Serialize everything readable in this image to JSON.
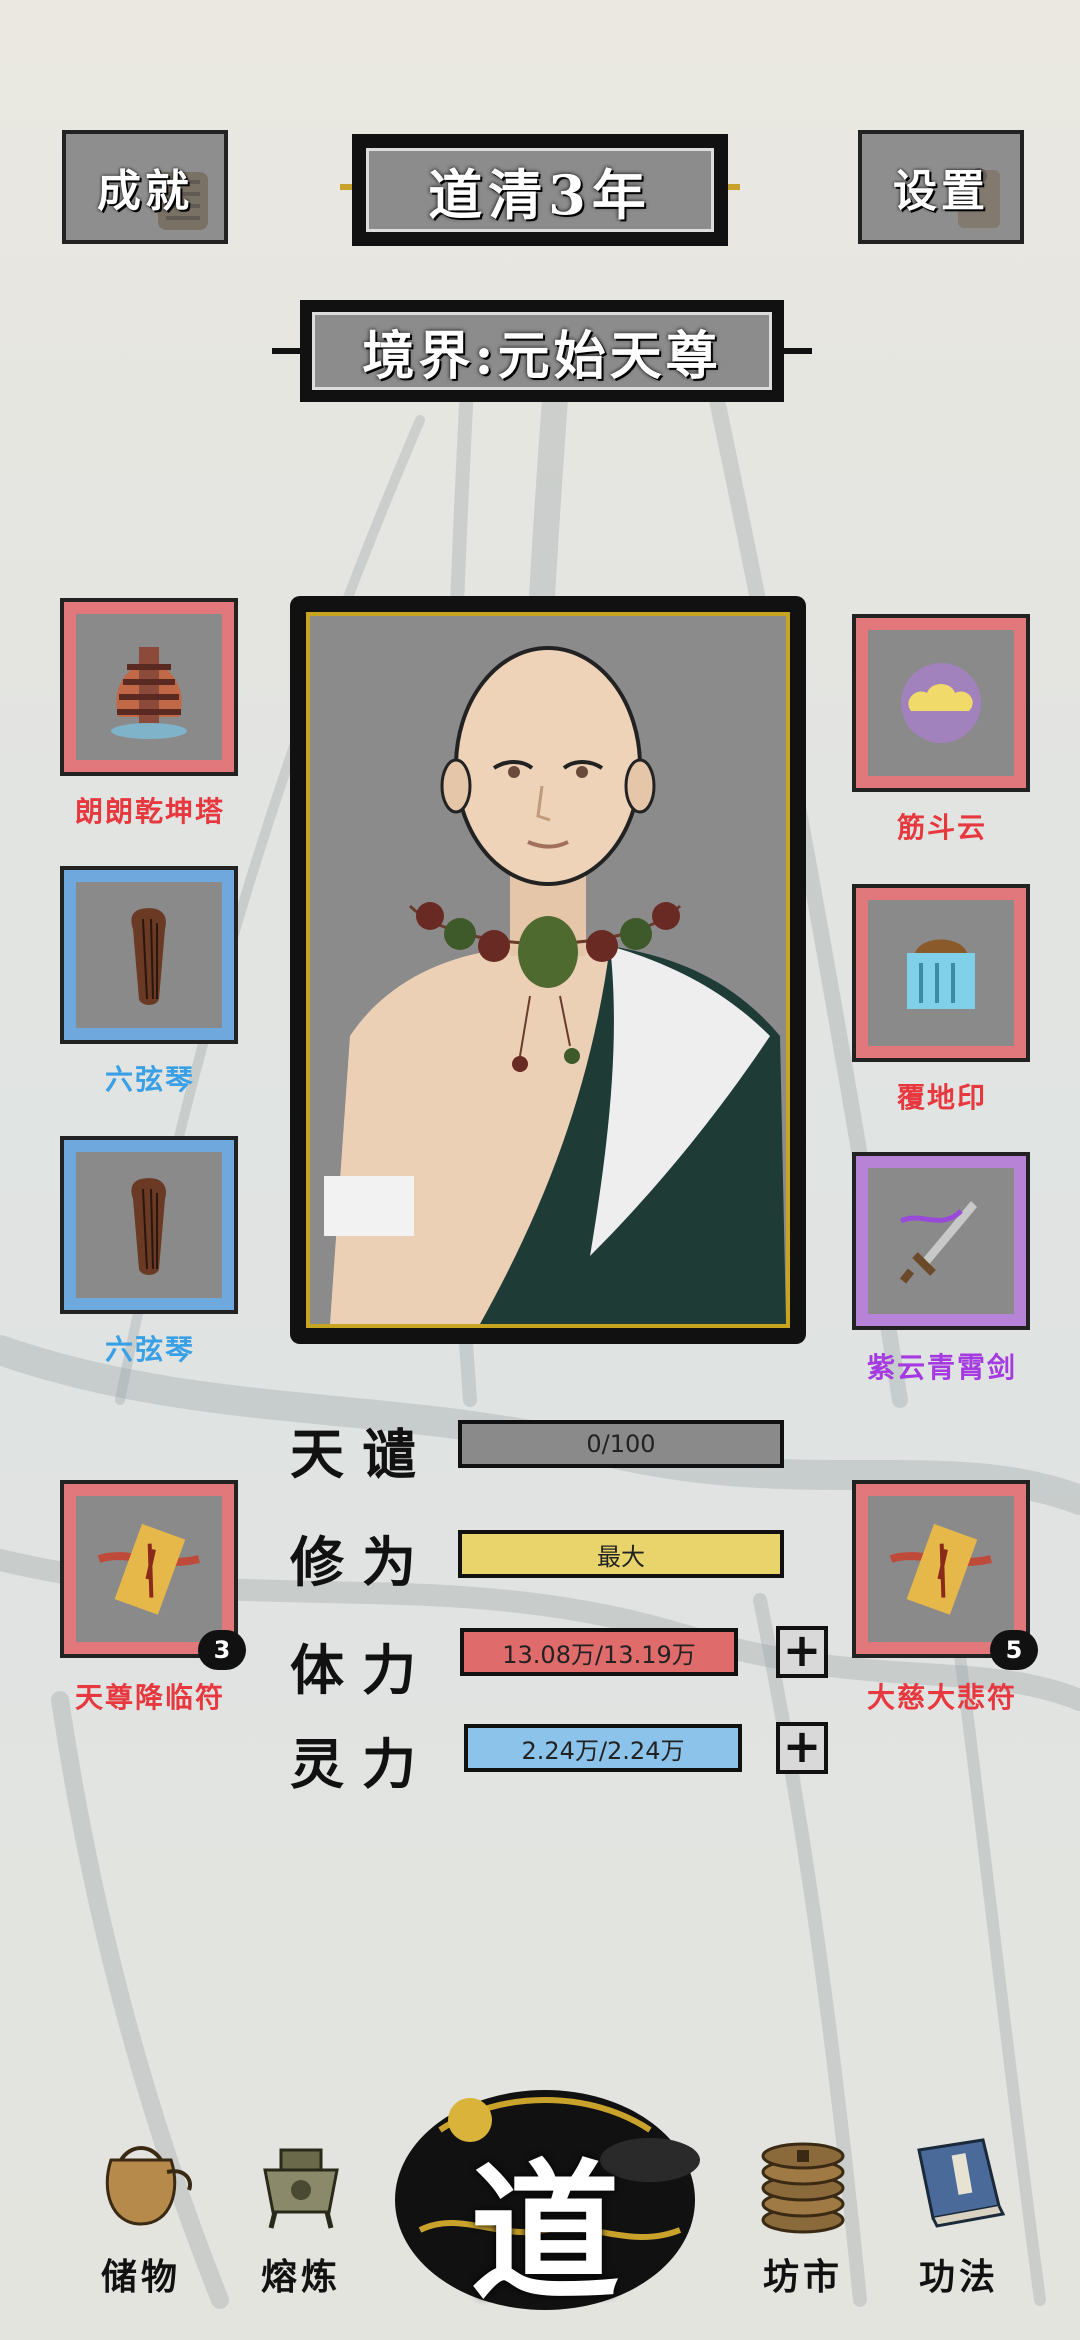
{
  "header": {
    "achievements_label": "成就",
    "year_title": "道清3年",
    "settings_label": "设置"
  },
  "realm": {
    "label": "境界:元始天尊"
  },
  "left_slots": [
    {
      "name": "朗朗乾坤塔",
      "icon": "pagoda-icon",
      "color": "#e0787c"
    },
    {
      "name": "六弦琴",
      "icon": "zither-icon",
      "color": "#6fa8dc"
    },
    {
      "name": "六弦琴",
      "icon": "zither-icon",
      "color": "#6fa8dc"
    },
    {
      "name": "天尊降临符",
      "icon": "talisman-icon",
      "color": "#e0787c",
      "count": "3"
    }
  ],
  "right_slots": [
    {
      "name": "筋斗云",
      "icon": "cloud-icon",
      "color": "#e0787c"
    },
    {
      "name": "覆地印",
      "icon": "seal-icon",
      "color": "#e0787c"
    },
    {
      "name": "紫云青霄剑",
      "icon": "sword-icon",
      "color": "#b783d6"
    },
    {
      "name": "大慈大悲符",
      "icon": "talisman-icon",
      "color": "#e0787c",
      "count": "5"
    }
  ],
  "stats": [
    {
      "label": "天谴",
      "value": "0/100",
      "color": "#8a8a8a"
    },
    {
      "label": "修为",
      "value": "最大",
      "color": "#e8d46a"
    },
    {
      "label": "体力",
      "value": "13.08万/13.19万",
      "color": "#e06b6b"
    },
    {
      "label": "灵力",
      "value": "2.24万/2.24万",
      "color": "#8cc3ea"
    }
  ],
  "nav": {
    "storage": "储物",
    "smelting": "熔炼",
    "center": "道",
    "market": "坊市",
    "skills": "功法"
  }
}
